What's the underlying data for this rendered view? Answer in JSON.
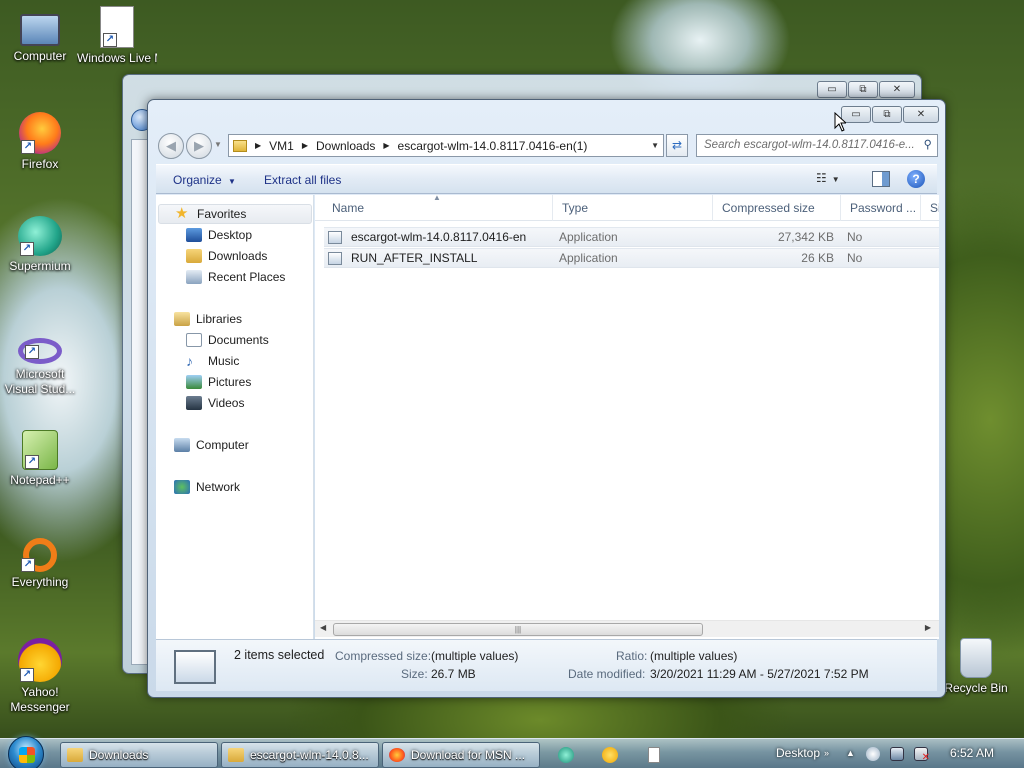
{
  "desktop": {
    "icons": [
      {
        "label": "Computer",
        "icon": "computer-icon"
      },
      {
        "label": "Windows Live Messen",
        "icon": "messenger-installer-icon"
      },
      {
        "label": "Firefox",
        "icon": "firefox-icon"
      },
      {
        "label": "Supermium",
        "icon": "supermium-icon"
      },
      {
        "label": "Microsoft Visual Stud...",
        "icon": "visual-studio-icon"
      },
      {
        "label": "Notepad++",
        "icon": "notepadpp-icon"
      },
      {
        "label": "Everything",
        "icon": "everything-icon"
      },
      {
        "label": "Yahoo! Messenger",
        "icon": "yahoo-messenger-icon"
      },
      {
        "label": "Recycle Bin",
        "icon": "recycle-bin-icon"
      }
    ]
  },
  "window": {
    "caption": {
      "minimize": "▭",
      "maximize": "⧉",
      "close": "✕"
    },
    "address": {
      "segments": [
        "VM1",
        "Downloads",
        "escargot-wlm-14.0.8117.0416-en(1)"
      ]
    },
    "search": {
      "placeholder": "Search escargot-wlm-14.0.8117.0416-e..."
    },
    "toolbar": {
      "organize": "Organize",
      "extract": "Extract all files",
      "help": "?"
    },
    "nav": {
      "favorites": "Favorites",
      "desktop": "Desktop",
      "downloads": "Downloads",
      "recent": "Recent Places",
      "libraries": "Libraries",
      "documents": "Documents",
      "music": "Music",
      "pictures": "Pictures",
      "videos": "Videos",
      "computer": "Computer",
      "network": "Network"
    },
    "columns": {
      "name": "Name",
      "type": "Type",
      "compressed": "Compressed size",
      "password": "Password ...",
      "size": "Si"
    },
    "files": [
      {
        "name": "escargot-wlm-14.0.8117.0416-en",
        "type": "Application",
        "compressed": "27,342 KB",
        "password": "No"
      },
      {
        "name": "RUN_AFTER_INSTALL",
        "type": "Application",
        "compressed": "26 KB",
        "password": "No"
      }
    ],
    "details": {
      "selected": "2 items selected",
      "compressed_label": "Compressed size:",
      "compressed_value": "(multiple values)",
      "size_label": "Size:",
      "size_value": "26.7 MB",
      "ratio_label": "Ratio:",
      "ratio_value": "(multiple values)",
      "date_label": "Date modified:",
      "date_value": "3/20/2021 11:29 AM - 5/27/2021 7:52 PM"
    }
  },
  "taskbar": {
    "buttons": [
      {
        "label": "Downloads"
      },
      {
        "label": "escargot-wlm-14.0.8..."
      },
      {
        "label": "Download for MSN ..."
      }
    ],
    "desktop_label": "Desktop",
    "clock": "6:52 AM"
  }
}
